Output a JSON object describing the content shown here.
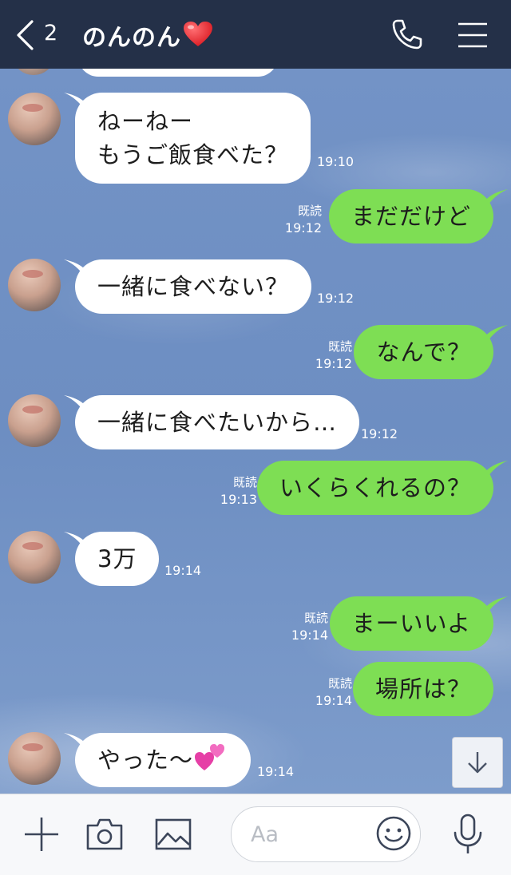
{
  "header": {
    "back_count": "2",
    "title": "のんのん",
    "heart_icon": "red-heart-emoji",
    "call_icon": "phone-icon",
    "menu_icon": "hamburger-menu-icon",
    "bg_color": "#243048"
  },
  "messages": [
    {
      "side": "in",
      "text": "ねーねー\nもうご飯食べた？",
      "time": "19:10"
    },
    {
      "side": "out",
      "text": "まだだけど",
      "read": "既読",
      "time": "19:12"
    },
    {
      "side": "in",
      "text": "一緒に食べない？",
      "time": "19:12"
    },
    {
      "side": "out",
      "text": "なんで？",
      "read": "既読",
      "time": "19:12"
    },
    {
      "side": "in",
      "text": "一緒に食べたいから…",
      "time": "19:12"
    },
    {
      "side": "out",
      "text": "いくらくれるの？",
      "read": "既読",
      "time": "19:13"
    },
    {
      "side": "in",
      "text": "3万",
      "time": "19:14"
    },
    {
      "side": "out",
      "text": "まーいいよ",
      "read": "既読",
      "time": "19:14"
    },
    {
      "side": "out",
      "text": "場所は？",
      "read": "既読",
      "time": "19:14"
    },
    {
      "side": "in",
      "text": "やった〜",
      "emoji": "two-hearts-emoji",
      "time": "19:14"
    }
  ],
  "colors": {
    "outgoing_bubble": "#7ede54",
    "incoming_bubble": "#ffffff",
    "chat_background": "#6e8fc2"
  },
  "input": {
    "placeholder": "Aa",
    "icons": [
      "plus-icon",
      "camera-icon",
      "image-icon",
      "emoji-icon",
      "microphone-icon"
    ]
  },
  "scroll_button_icon": "arrow-down-icon"
}
